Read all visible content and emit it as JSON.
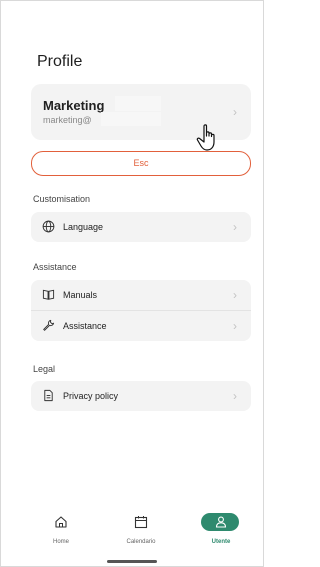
{
  "page": {
    "title": "Profile"
  },
  "account": {
    "name": "Marketing",
    "email": "marketing@"
  },
  "logout": {
    "label": "Esc"
  },
  "sections": {
    "customisation": {
      "label": "Customisation",
      "items": [
        {
          "label": "Language",
          "icon": "globe-icon"
        }
      ]
    },
    "assistance": {
      "label": "Assistance",
      "items": [
        {
          "label": "Manuals",
          "icon": "book-icon"
        },
        {
          "label": "Assistance",
          "icon": "wrench-icon"
        }
      ]
    },
    "legal": {
      "label": "Legal",
      "items": [
        {
          "label": "Privacy policy",
          "icon": "document-icon"
        }
      ]
    }
  },
  "nav": {
    "items": [
      {
        "label": "Home",
        "icon": "home-icon",
        "active": false
      },
      {
        "label": "Calendario",
        "icon": "calendar-icon",
        "active": false
      },
      {
        "label": "Utente",
        "icon": "user-icon",
        "active": true
      }
    ]
  },
  "colors": {
    "accent": "#2e8a6e",
    "danger": "#e2603b",
    "card": "#f3f3f3"
  }
}
